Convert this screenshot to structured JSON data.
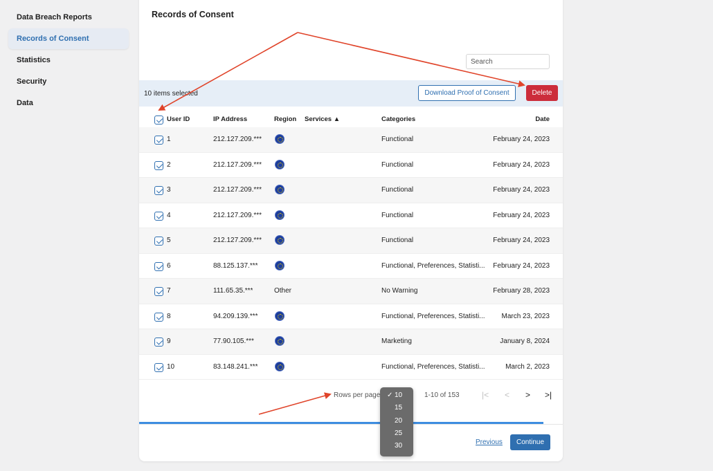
{
  "sidebar": {
    "items": [
      {
        "label": "Data Breach Reports",
        "active": false
      },
      {
        "label": "Records of Consent",
        "active": true
      },
      {
        "label": "Statistics",
        "active": false
      },
      {
        "label": "Security",
        "active": false
      },
      {
        "label": "Data",
        "active": false
      }
    ]
  },
  "card": {
    "title": "Records of Consent",
    "search_placeholder": "Search",
    "selection_text": "10 items selected",
    "download_label": "Download Proof of Consent",
    "delete_label": "Delete"
  },
  "table": {
    "columns": [
      "User ID",
      "IP Address",
      "Region",
      "Services ▲",
      "Categories",
      "Date"
    ],
    "rows": [
      {
        "id": "1",
        "ip": "212.127.209.***",
        "region": "eu-flag-icon",
        "region_text": "",
        "services": "",
        "categories": "Functional",
        "date": "February 24, 2023"
      },
      {
        "id": "2",
        "ip": "212.127.209.***",
        "region": "eu-flag-icon",
        "region_text": "",
        "services": "",
        "categories": "Functional",
        "date": "February 24, 2023"
      },
      {
        "id": "3",
        "ip": "212.127.209.***",
        "region": "eu-flag-icon",
        "region_text": "",
        "services": "",
        "categories": "Functional",
        "date": "February 24, 2023"
      },
      {
        "id": "4",
        "ip": "212.127.209.***",
        "region": "eu-flag-icon",
        "region_text": "",
        "services": "",
        "categories": "Functional",
        "date": "February 24, 2023"
      },
      {
        "id": "5",
        "ip": "212.127.209.***",
        "region": "eu-flag-icon",
        "region_text": "",
        "services": "",
        "categories": "Functional",
        "date": "February 24, 2023"
      },
      {
        "id": "6",
        "ip": "88.125.137.***",
        "region": "eu-flag-icon",
        "region_text": "",
        "services": "",
        "categories": "Functional, Preferences, Statisti...",
        "date": "February 24, 2023"
      },
      {
        "id": "7",
        "ip": "111.65.35.***",
        "region": "text",
        "region_text": "Other",
        "services": "",
        "categories": "No Warning",
        "date": "February 28, 2023"
      },
      {
        "id": "8",
        "ip": "94.209.139.***",
        "region": "eu-flag-icon",
        "region_text": "",
        "services": "",
        "categories": "Functional, Preferences, Statisti...",
        "date": "March 23, 2023"
      },
      {
        "id": "9",
        "ip": "77.90.105.***",
        "region": "eu-flag-icon",
        "region_text": "",
        "services": "",
        "categories": "Marketing",
        "date": "January 8, 2024"
      },
      {
        "id": "10",
        "ip": "83.148.241.***",
        "region": "eu-flag-icon",
        "region_text": "",
        "services": "",
        "categories": "Functional, Preferences, Statisti...",
        "date": "March 2, 2023"
      }
    ]
  },
  "pagination": {
    "rows_label": "Rows per page:",
    "range": "1-10 of 153",
    "first": "|<",
    "prev": "<",
    "next": ">",
    "last": ">|"
  },
  "rows_dropdown": {
    "options": [
      "10",
      "15",
      "20",
      "25",
      "30"
    ],
    "selected": "10",
    "check": "✓"
  },
  "progress": {
    "fraction": 0.955
  },
  "footer": {
    "previous_label": "Previous",
    "continue_label": "Continue"
  },
  "colors": {
    "accent": "#2f6fb0",
    "danger": "#cc2d3b",
    "annotation": "#e0442a"
  }
}
